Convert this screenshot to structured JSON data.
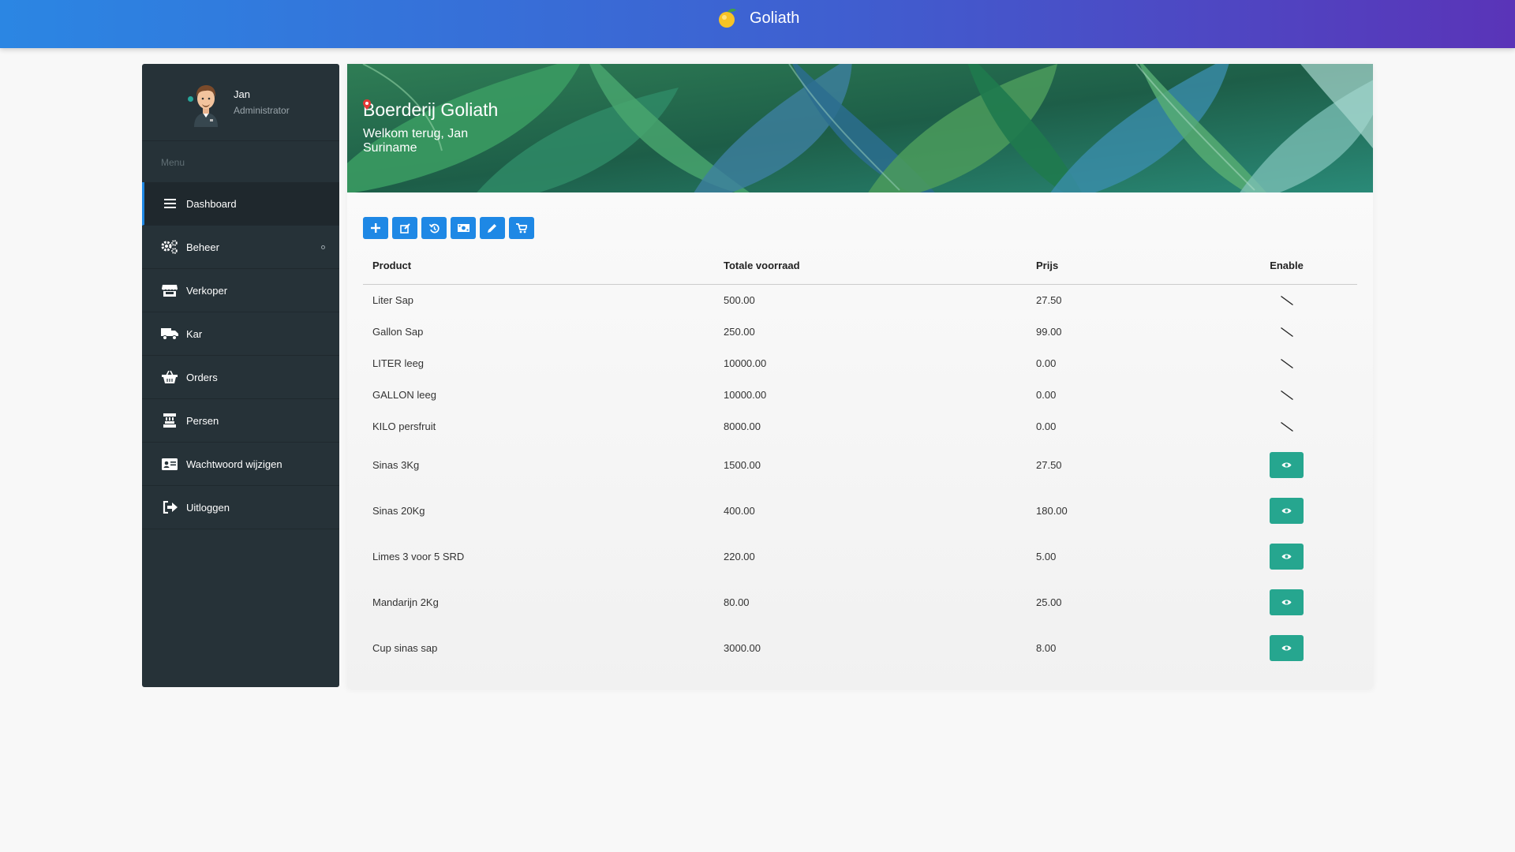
{
  "app": {
    "name": "Goliath"
  },
  "user": {
    "name": "Jan",
    "role": "Administrator"
  },
  "sidebar": {
    "menu_header": "Menu",
    "items": [
      {
        "label": "Dashboard",
        "icon": "bars-icon"
      },
      {
        "label": "Beheer",
        "icon": "cogs-icon"
      },
      {
        "label": "Verkoper",
        "icon": "store-icon"
      },
      {
        "label": "Kar",
        "icon": "truck-icon"
      },
      {
        "label": "Orders",
        "icon": "basket-icon"
      },
      {
        "label": "Persen",
        "icon": "press-icon"
      },
      {
        "label": "Wachtwoord wijzigen",
        "icon": "id-card-icon"
      },
      {
        "label": "Uitloggen",
        "icon": "sign-out-icon"
      }
    ]
  },
  "banner": {
    "title": "Boerderij Goliath",
    "welcome": "Welkom terug, Jan",
    "location": "Suriname"
  },
  "toolbar": {
    "buttons": [
      "plus-icon",
      "edit-icon",
      "history-icon",
      "money-icon",
      "pencil-icon",
      "cart-icon"
    ]
  },
  "table": {
    "headers": [
      "Product",
      "Totale voorraad",
      "Prijs",
      "Enable"
    ],
    "rows": [
      {
        "product": "Liter Sap",
        "stock": "500.00",
        "price": "27.50",
        "enable": "disabled"
      },
      {
        "product": "Gallon Sap",
        "stock": "250.00",
        "price": "99.00",
        "enable": "disabled"
      },
      {
        "product": "LITER leeg",
        "stock": "10000.00",
        "price": "0.00",
        "enable": "disabled"
      },
      {
        "product": "GALLON leeg",
        "stock": "10000.00",
        "price": "0.00",
        "enable": "disabled"
      },
      {
        "product": "KILO persfruit",
        "stock": "8000.00",
        "price": "0.00",
        "enable": "disabled"
      },
      {
        "product": "Sinas 3Kg",
        "stock": "1500.00",
        "price": "27.50",
        "enable": "view"
      },
      {
        "product": "Sinas 20Kg",
        "stock": "400.00",
        "price": "180.00",
        "enable": "view"
      },
      {
        "product": "Limes 3 voor 5 SRD",
        "stock": "220.00",
        "price": "5.00",
        "enable": "view"
      },
      {
        "product": "Mandarijn 2Kg",
        "stock": "80.00",
        "price": "25.00",
        "enable": "view"
      },
      {
        "product": "Cup sinas sap",
        "stock": "3000.00",
        "price": "8.00",
        "enable": "view"
      }
    ]
  },
  "colors": {
    "primary": "#1e88e5",
    "success": "#26a68f",
    "sidebar": "#263238",
    "location_pin": "#e53935"
  }
}
